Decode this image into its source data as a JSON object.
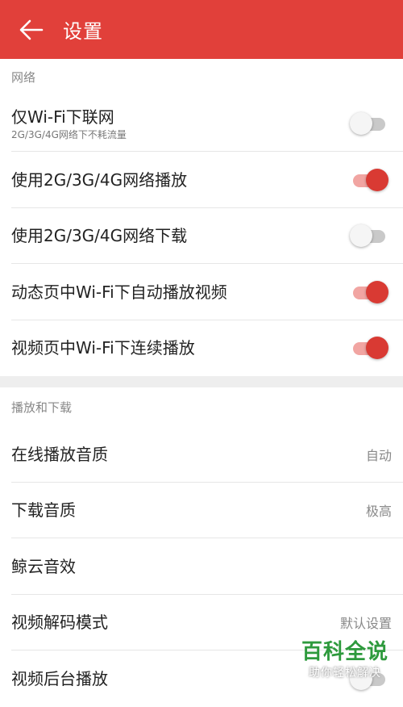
{
  "header": {
    "title": "设置",
    "background": "#e1403a"
  },
  "network_section": {
    "title": "网络",
    "items": [
      {
        "label": "仅Wi-Fi下联网",
        "subtitle": "2G/3G/4G网络下不耗流量",
        "toggle_on": false
      },
      {
        "label": "使用2G/3G/4G网络播放",
        "toggle_on": true
      },
      {
        "label": "使用2G/3G/4G网络下载",
        "toggle_on": false
      },
      {
        "label": "动态页中Wi-Fi下自动播放视频",
        "toggle_on": true
      },
      {
        "label": "视频页中Wi-Fi下连续播放",
        "toggle_on": true
      }
    ]
  },
  "playback_section": {
    "title": "播放和下载",
    "items": [
      {
        "label": "在线播放音质",
        "value": "自动"
      },
      {
        "label": "下载音质",
        "value": "极高"
      },
      {
        "label": "鲸云音效",
        "value": ""
      },
      {
        "label": "视频解码模式",
        "value": "默认设置"
      },
      {
        "label": "视频后台播放",
        "toggle_on": false
      }
    ]
  },
  "watermark": {
    "title": "百科全说",
    "subtitle": "助你轻松解决"
  },
  "colors": {
    "accent": "#d93a33",
    "accent_track": "#f1a5a2",
    "watermark_green": "#2e9a3d"
  },
  "icons": {
    "back": "arrow-left-icon"
  }
}
